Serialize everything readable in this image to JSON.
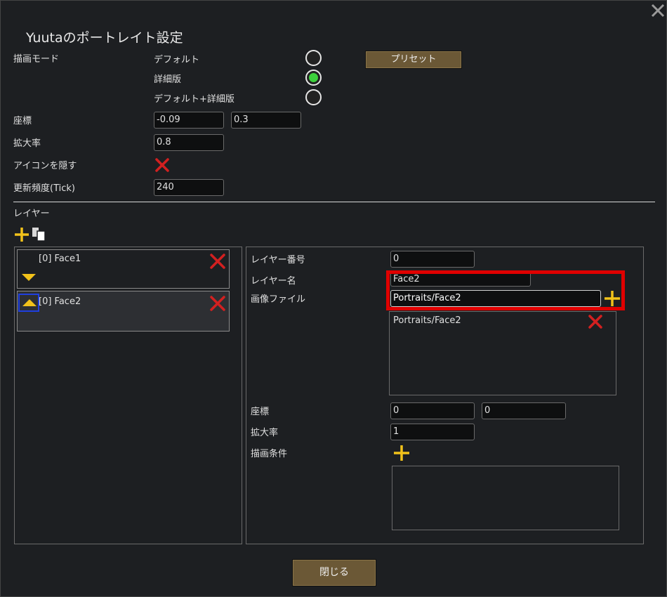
{
  "dialog": {
    "title": "Yuutaのポートレイト設定",
    "close_icon": "close-icon"
  },
  "draw_mode": {
    "label": "描画モード",
    "options": [
      {
        "label": "デフォルト",
        "selected": false
      },
      {
        "label": "詳細版",
        "selected": true
      },
      {
        "label": "デフォルト+詳細版",
        "selected": false
      }
    ],
    "preset_button": "プリセット"
  },
  "coords": {
    "label": "座標",
    "x": "-0.09",
    "y": "0.3"
  },
  "scale": {
    "label": "拡大率",
    "value": "0.8"
  },
  "hide_icon": {
    "label": "アイコンを隠す",
    "checked": false
  },
  "update_freq": {
    "label": "更新頻度(Tick)",
    "value": "240"
  },
  "layers_section": {
    "label": "レイヤー"
  },
  "layers": [
    {
      "name": "[0] Face1",
      "selected": false
    },
    {
      "name": "[0] Face2",
      "selected": true
    }
  ],
  "layer_detail": {
    "number_label": "レイヤー番号",
    "number_value": "0",
    "name_label": "レイヤー名",
    "name_value": "Face2",
    "image_label": "画像ファイル",
    "image_value": "Portraits/Face2",
    "image_list": [
      "Portraits/Face2"
    ],
    "coords_label": "座標",
    "coord_x": "0",
    "coord_y": "0",
    "scale_label": "拡大率",
    "scale_value": "1",
    "condition_label": "描画条件"
  },
  "close_button": "閉じる",
  "colors": {
    "accent_plus": "#f2c21a",
    "delete_red": "#d32020",
    "radio_on": "#3cd13c",
    "highlight_box": "#e00000",
    "button_brown": "#6b5836"
  }
}
